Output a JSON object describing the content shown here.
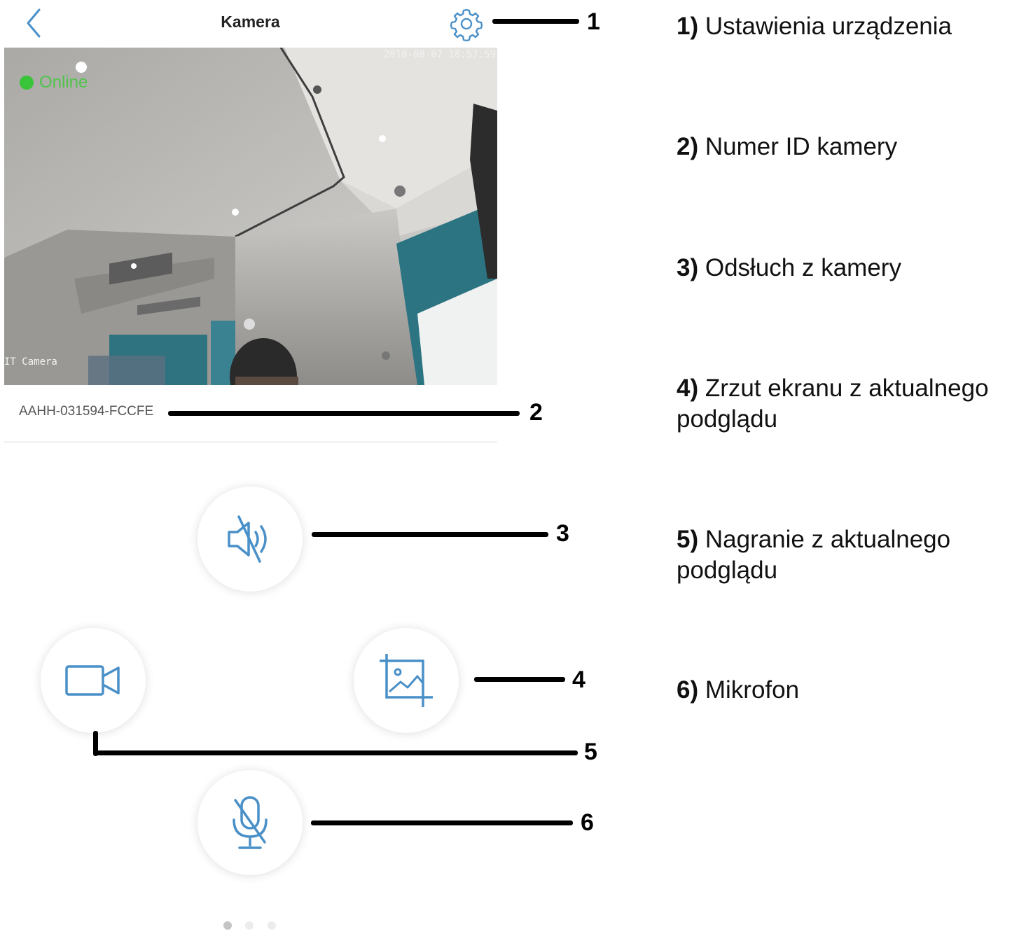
{
  "app": {
    "title": "Kamera",
    "accent_color": "#4a90c8"
  },
  "camera": {
    "status": "Online",
    "timestamp": "2018-08-07 18:57:59",
    "label": "IT Camera",
    "device_id": "AAHH-031594-FCCFE"
  },
  "controls": {
    "listen_icon": "speaker-muted-icon",
    "record_icon": "video-camera-icon",
    "snapshot_icon": "image-crop-icon",
    "mic_icon": "microphone-muted-icon"
  },
  "pagination": {
    "pages": 3,
    "active": 1
  },
  "annotations": {
    "n1": "1",
    "n2": "2",
    "n3": "3",
    "n4": "4",
    "n5": "5",
    "n6": "6"
  },
  "legend": [
    {
      "num": "1)",
      "text": "Ustawienia urządzenia",
      "text2": ""
    },
    {
      "num": "2)",
      "text": "Numer ID kamery",
      "text2": ""
    },
    {
      "num": "3)",
      "text": "Odsłuch z kamery",
      "text2": ""
    },
    {
      "num": "4)",
      "text": "Zrzut ekranu z aktualnego",
      "text2": "podglądu"
    },
    {
      "num": "5)",
      "text": "Nagranie z aktualnego",
      "text2": "podglądu"
    },
    {
      "num": "6)",
      "text": "Mikrofon",
      "text2": ""
    }
  ]
}
